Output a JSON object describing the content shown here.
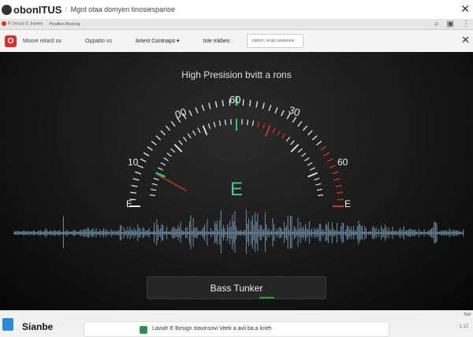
{
  "titlebar": {
    "app_name": "obonITUS",
    "subtitle": "Mgot otaa domyen tinosiesparioe"
  },
  "bookmarks": {
    "item1": "R Orouss D Jobwes",
    "item2": "Pecdtion Bnsiong"
  },
  "nav": {
    "item1": "Moore relard ox",
    "item2": "Oppatto vs",
    "item3": "Arient Contnaps",
    "item4": "Inle mkbes",
    "search_placeholder": "Vattym, incipt candenew"
  },
  "gauge": {
    "title": "High Presision bvitt a rons",
    "note": "E",
    "labels": {
      "left_end": "E",
      "left": "10",
      "upper_left": "00",
      "top": "60",
      "upper_right": "30",
      "right": "60",
      "right_end": "E"
    },
    "colors": {
      "ok": "#2ecc71",
      "warn": "#d0392b",
      "tick": "#e8e8e8",
      "wave": "#6f8ea5"
    }
  },
  "button": {
    "label": "Bass Tunker"
  },
  "footer": {
    "name": "Sianbe",
    "card_text": "Laviah E Besign stavinsovi Veek a avii ba a krieh",
    "right1": "Ner",
    "right2": "1.12"
  }
}
